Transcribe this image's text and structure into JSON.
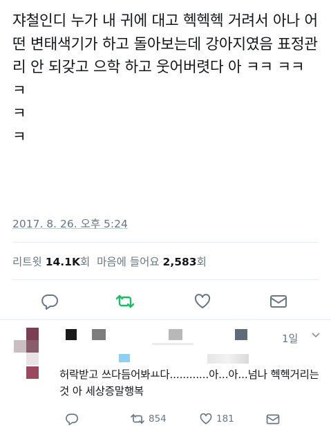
{
  "tweet": {
    "text": "쟈철인디 누가 내 귀에 대고 헥헥헥 거려서 아나 어떤 변태색기가 하고 돌아보는데 강아지였음 표정관리 안 되갖고 으학 하고 웃어버렷다 아 ㅋㅋ ㅋㅋ\nㅋ\nㅋ\nㅋ",
    "timestamp": "2017. 8. 26. 오후 5:24",
    "stats": {
      "retweet_label": "리트윗",
      "retweet_count": "14.1K",
      "retweet_unit": "회",
      "like_label": "마음에 들어요",
      "like_count": "2,583",
      "like_unit": "회"
    }
  },
  "actions": {
    "reply_icon": "reply-icon",
    "retweet_icon": "retweet-icon",
    "like_icon": "heart-icon",
    "message_icon": "message-icon",
    "retweet_color": "#17bf63"
  },
  "reply": {
    "date": "1일",
    "text": "허락받고 쓰다듬어봐ㅛ다............아...아...넘나 헥헥거리는것 아 세상증말행복",
    "retweet_count": "854",
    "like_count": "181"
  }
}
